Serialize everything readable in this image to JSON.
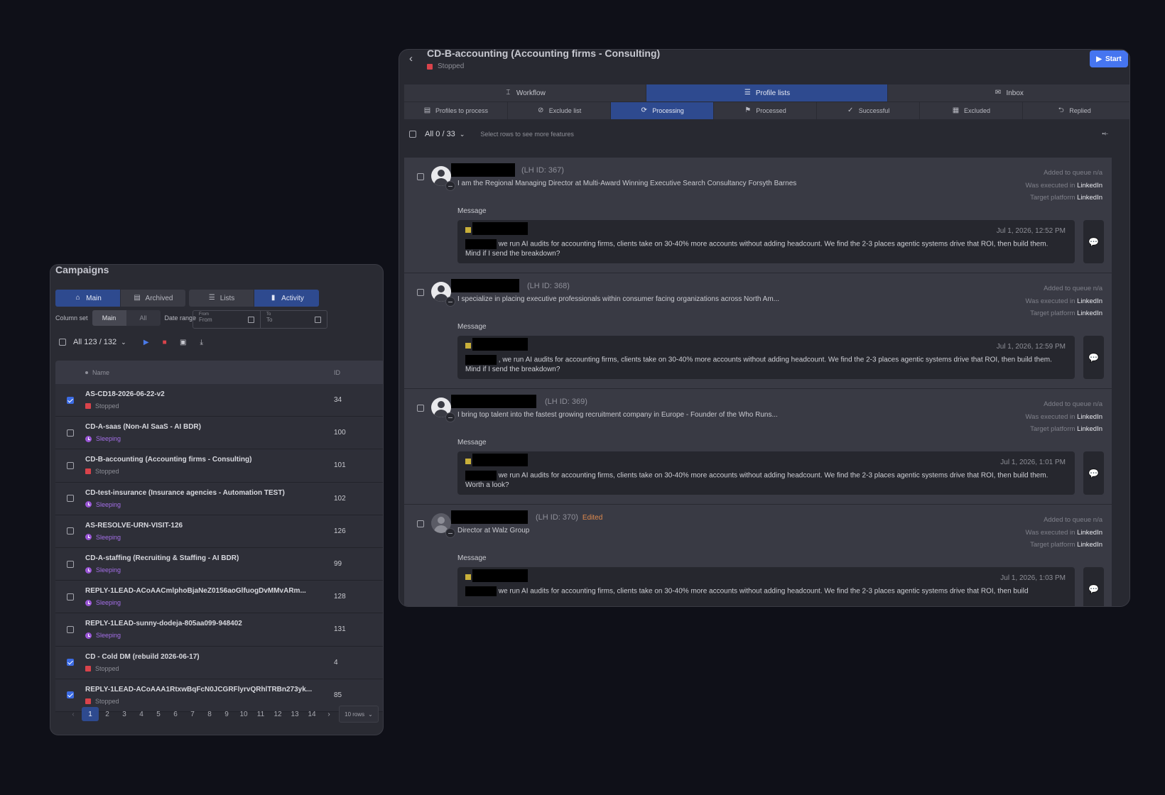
{
  "campaigns": {
    "title": "Campaigns",
    "views": [
      {
        "label": "Main",
        "icon": "home-icon",
        "active": true
      },
      {
        "label": "Archived",
        "icon": "archive-icon",
        "active": false
      }
    ],
    "modes": [
      {
        "label": "Lists",
        "icon": "list-icon",
        "active": false
      },
      {
        "label": "Activity",
        "icon": "bar-chart-icon",
        "active": true
      }
    ],
    "column_set_label": "Column set",
    "column_set_options": [
      "Main",
      "All"
    ],
    "date_range_label": "Date range",
    "date_from_label": "From",
    "date_from_placeholder": "From",
    "date_to_label": "To",
    "date_to_placeholder": "To",
    "selection_summary": "All 123 / 132",
    "columns": {
      "name": "Name",
      "id": "ID"
    },
    "rows": [
      {
        "name": "AS-CD18-2026-06-22-v2",
        "status": "Stopped",
        "status_type": "stopped",
        "id": "34",
        "checked": true
      },
      {
        "name": "CD-A-saas (Non-AI SaaS - AI BDR)",
        "status": "Sleeping",
        "status_type": "sleeping",
        "id": "100",
        "checked": false
      },
      {
        "name": "CD-B-accounting (Accounting firms - Consulting)",
        "status": "Stopped",
        "status_type": "stopped",
        "id": "101",
        "checked": false
      },
      {
        "name": "CD-test-insurance (Insurance agencies - Automation TEST)",
        "status": "Sleeping",
        "status_type": "sleeping",
        "id": "102",
        "checked": false
      },
      {
        "name": "AS-RESOLVE-URN-VISIT-126",
        "status": "Sleeping",
        "status_type": "sleeping",
        "id": "126",
        "checked": false
      },
      {
        "name": "CD-A-staffing (Recruiting & Staffing - AI BDR)",
        "status": "Sleeping",
        "status_type": "sleeping",
        "id": "99",
        "checked": false
      },
      {
        "name": "REPLY-1LEAD-ACoAACmlphoBjaNeZ0156aoGlfuogDvMMvARm...",
        "status": "Sleeping",
        "status_type": "sleeping",
        "id": "128",
        "checked": false
      },
      {
        "name": "REPLY-1LEAD-sunny-dodeja-805aa099-948402",
        "status": "Sleeping",
        "status_type": "sleeping",
        "id": "131",
        "checked": false
      },
      {
        "name": "CD - Cold DM (rebuild 2026-06-17)",
        "status": "Stopped",
        "status_type": "stopped",
        "id": "4",
        "checked": true
      },
      {
        "name": "REPLY-1LEAD-ACoAAA1RtxwBqFcN0JCGRFlyrvQRhlTRBn273yk...",
        "status": "Stopped",
        "status_type": "stopped",
        "id": "85",
        "checked": true
      }
    ],
    "pages": [
      "1",
      "2",
      "3",
      "4",
      "5",
      "6",
      "7",
      "8",
      "9",
      "10",
      "11",
      "12",
      "13",
      "14"
    ],
    "current_page": "1",
    "rows_per_page": "10 rows"
  },
  "detail": {
    "title": "CD-B-accounting (Accounting firms - Consulting)",
    "status": "Stopped",
    "start_label": "Start",
    "main_tabs": [
      {
        "label": "Workflow",
        "icon": "workflow-icon",
        "active": false
      },
      {
        "label": "Profile lists",
        "icon": "list-icon",
        "active": true
      },
      {
        "label": "Inbox",
        "icon": "mail-icon",
        "active": false
      }
    ],
    "sub_tabs": [
      {
        "label": "Profiles to process",
        "icon": "queue-icon",
        "active": false
      },
      {
        "label": "Exclude list",
        "icon": "block-icon",
        "active": false
      },
      {
        "label": "Processing",
        "icon": "refresh-icon",
        "active": true
      },
      {
        "label": "Processed",
        "icon": "flag-icon",
        "active": false
      },
      {
        "label": "Successful",
        "icon": "check-icon",
        "active": false
      },
      {
        "label": "Excluded",
        "icon": "excluded-icon",
        "active": false
      },
      {
        "label": "Replied",
        "icon": "reply-icon",
        "active": false
      }
    ],
    "selection_summary": "All 0 / 33",
    "selection_hint": "Select rows to see more features",
    "profiles": [
      {
        "lh_id": "(LH ID: 367)",
        "edited": "",
        "headline": "I am the Regional Managing Director at Multi-Award Winning Executive Search Consultancy Forsyth Barnes",
        "added": "Added to queue n/a",
        "executed_label": "Was executed in",
        "executed_value": "LinkedIn",
        "platform_label": "Target platform",
        "platform_value": "LinkedIn",
        "message_label": "Message",
        "time": "Jul 1, 2026, 12:52 PM",
        "message": "we run AI audits for accounting firms, clients take on 30-40% more accounts without adding headcount. We find the 2-3 places agentic systems drive that ROI, then build them. Mind if I send the breakdown?",
        "avatar": "photo"
      },
      {
        "lh_id": "(LH ID: 368)",
        "edited": "",
        "headline": "I specialize in placing executive professionals within consumer facing organizations across North Am...",
        "added": "Added to queue n/a",
        "executed_label": "Was executed in",
        "executed_value": "LinkedIn",
        "platform_label": "Target platform",
        "platform_value": "LinkedIn",
        "message_label": "Message",
        "time": "Jul 1, 2026, 12:59 PM",
        "message": ", we run AI audits for accounting firms, clients take on 30-40% more accounts without adding headcount. We find the 2-3 places agentic systems drive that ROI, then build them. Mind if I send the breakdown?",
        "avatar": "photo"
      },
      {
        "lh_id": "(LH ID: 369)",
        "edited": "",
        "headline": "I bring top talent into the fastest growing recruitment company in Europe - Founder of the Who Runs...",
        "added": "Added to queue n/a",
        "executed_label": "Was executed in",
        "executed_value": "LinkedIn",
        "platform_label": "Target platform",
        "platform_value": "LinkedIn",
        "message_label": "Message",
        "time": "Jul 1, 2026, 1:01 PM",
        "message": "we run AI audits for accounting firms, clients take on 30-40% more accounts without adding headcount. We find the 2-3 places agentic systems drive that ROI, then build them. Worth a look?",
        "avatar": "photo"
      },
      {
        "lh_id": "(LH ID: 370)",
        "edited": "Edited",
        "headline": "Director at Walz Group",
        "added": "Added to queue n/a",
        "executed_label": "Was executed in",
        "executed_value": "LinkedIn",
        "platform_label": "Target platform",
        "platform_value": "LinkedIn",
        "message_label": "Message",
        "time": "Jul 1, 2026, 1:03 PM",
        "message": "we run AI audits for accounting firms, clients take on 30-40% more accounts without adding headcount. We find the 2-3 places agentic systems drive that ROI, then build",
        "avatar": "generic"
      }
    ]
  },
  "colors": {
    "background": "#0f1018",
    "panel": "#2a2b33",
    "accent": "#2e4a8f",
    "start_button": "#4675f0",
    "stopped": "#d9434b",
    "sleeping": "#9a55d6",
    "edited": "#e08a4d"
  }
}
